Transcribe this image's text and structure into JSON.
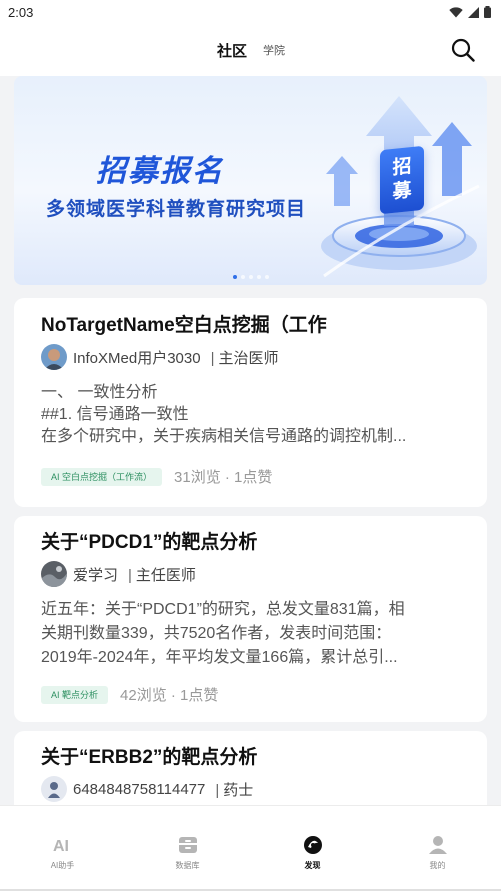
{
  "status_bar": {
    "time": "2:03"
  },
  "top_tabs": {
    "active": "社区",
    "secondary": "学院"
  },
  "banner": {
    "title": "招募报名",
    "subtitle": "多领域医学科普教育研究项目",
    "badge_line1": "招",
    "badge_line2": "募",
    "slides_count": 5,
    "active_slide": 1
  },
  "posts": [
    {
      "title": "NoTargetName空白点挖掘（工作",
      "author": "InfoXMed用户3030",
      "role": "主治医师",
      "lines": [
        "一、 一致性分析",
        "##1. 信号通路一致性",
        "在多个研究中，关于疾病相关信号通路的调控机制..."
      ],
      "tag": "AI 空白点挖掘（工作流）",
      "stats": "31浏览 · 1点赞"
    },
    {
      "title": "关于“PDCD1”的靶点分析",
      "author": "爱学习",
      "role": "主任医师",
      "lines": [
        "近五年：关于“PDCD1”的研究，总发文量831篇，相",
        "关期刊数量339，共7520名作者，发表时间范围：",
        "2019年-2024年，年平均发文量166篇，累计总引..."
      ],
      "tag": "AI 靶点分析",
      "stats": "42浏览 · 1点赞"
    },
    {
      "title": "关于“ERBB2”的靶点分析",
      "author": "6484848758114477",
      "role": "药士"
    }
  ],
  "bottom_nav": [
    {
      "label": "AI助手",
      "icon": "ai-assistant-icon"
    },
    {
      "label": "数据库",
      "icon": "database-icon"
    },
    {
      "label": "发现",
      "icon": "discover-icon",
      "active": true
    },
    {
      "label": "我的",
      "icon": "profile-icon"
    }
  ],
  "colors": {
    "accent": "#1f56d9",
    "tag_bg": "#e6f5ee",
    "tag_text": "#2c8f60",
    "background": "#f2f3f5"
  }
}
